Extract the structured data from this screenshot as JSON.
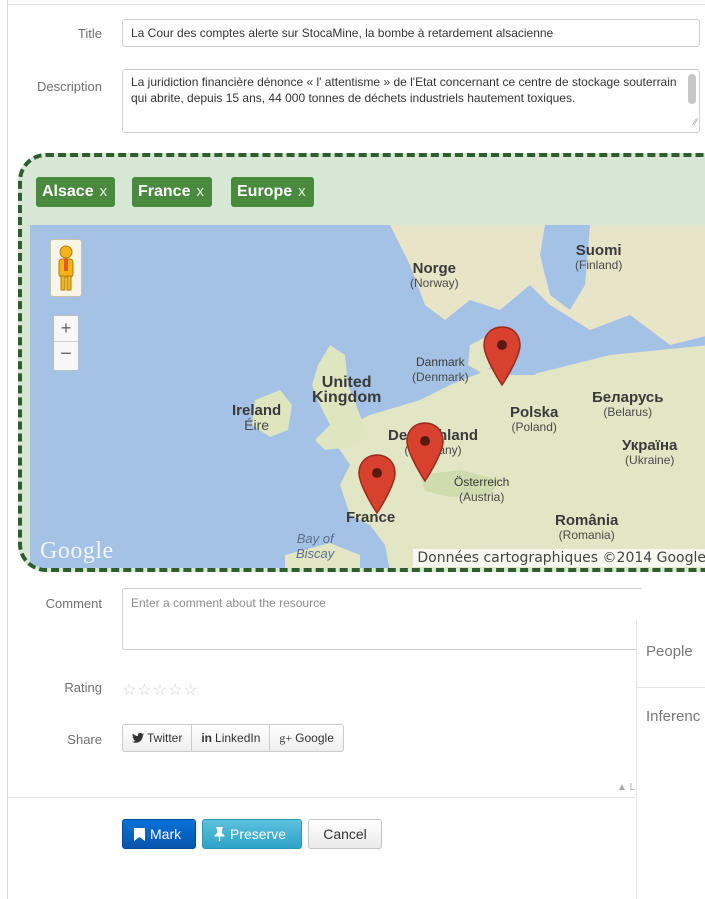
{
  "form": {
    "title_label": "Title",
    "title_value": "La Cour des comptes alerte sur StocaMine, la bombe à retardement alsacienne",
    "description_label": "Description",
    "description_value": "La juridiction financière dénonce « l' attentisme » de l'Etat concernant ce centre de stockage souterrain qui abrite, depuis 15 ans, 44 000 tonnes de déchets industriels hautement toxiques.",
    "comment_label": "Comment",
    "comment_placeholder": "Enter a comment about the resource",
    "rating_label": "Rating",
    "rating_stars": "☆☆☆☆☆",
    "rating_value": 0,
    "share_label": "Share"
  },
  "tags": [
    {
      "label": "Alsace",
      "remove": "x"
    },
    {
      "label": "France",
      "remove": "x"
    },
    {
      "label": "Europe",
      "remove": "x"
    }
  ],
  "map": {
    "zoom_in": "+",
    "zoom_out": "−",
    "logo": "Google",
    "attribution": "Données cartographiques ©2014 Google",
    "places": [
      {
        "name": "Suomi",
        "sub": "(Finland)"
      },
      {
        "name": "Norge",
        "sub": "(Norway)"
      },
      {
        "name": "Danmark",
        "sub": "(Denmark)"
      },
      {
        "name": "United",
        "sub": "Kingdom"
      },
      {
        "name": "Ireland",
        "sub": "Éire"
      },
      {
        "name": "Polska",
        "sub": "(Poland)"
      },
      {
        "name": "Беларусь",
        "sub": "(Belarus)"
      },
      {
        "name": "Deutschland",
        "sub": "(Germany)"
      },
      {
        "name": "Україна",
        "sub": "(Ukraine)"
      },
      {
        "name": "Österreich",
        "sub": "(Austria)"
      },
      {
        "name": "France",
        "sub": ""
      },
      {
        "name": "România",
        "sub": "(Romania)"
      },
      {
        "name": "Bay of",
        "sub": "Biscay"
      }
    ],
    "pin_color": "#d9412f"
  },
  "share": [
    {
      "icon": "twitter-icon",
      "label": "Twitter"
    },
    {
      "icon": "linkedin-icon",
      "label": "LinkedIn",
      "prefix": "in"
    },
    {
      "icon": "google-plus-icon",
      "label": "Google",
      "prefix": "g+"
    }
  ],
  "side_panel": {
    "people": "People",
    "inferences": "Inferenc",
    "corner_text": "▲ L"
  },
  "actions": {
    "mark": "Mark",
    "preserve": "Preserve",
    "cancel": "Cancel"
  },
  "colors": {
    "tag_green": "#4a8a3f",
    "highlight_border": "#2e5e2b",
    "mark_blue": "#0754ad",
    "preserve_cyan": "#2fa4c8"
  }
}
